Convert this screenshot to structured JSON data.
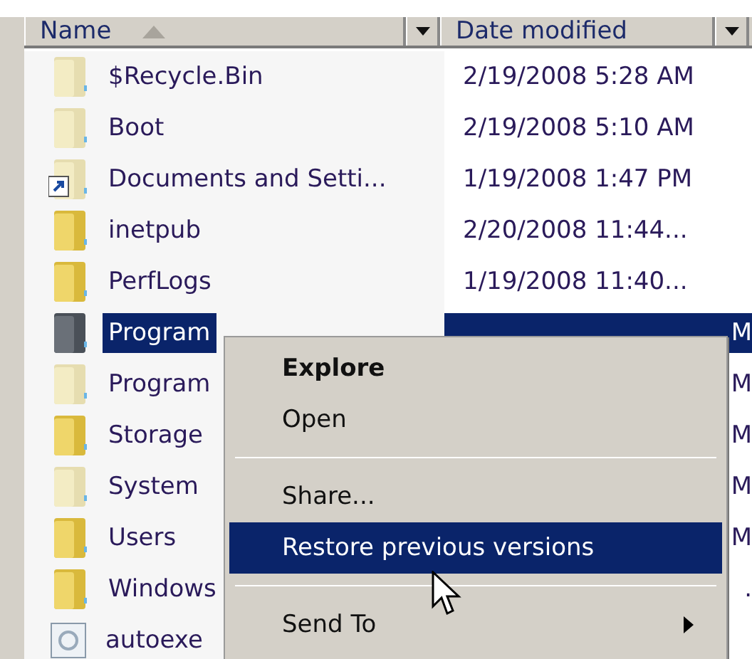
{
  "columns": [
    {
      "label": "Name",
      "sorted": true
    },
    {
      "label": "Date modified",
      "sorted": false
    }
  ],
  "rows": [
    {
      "name": "$Recycle.Bin",
      "date": "2/19/2008 5:28 AM",
      "kind": "hidden-folder",
      "selected": false
    },
    {
      "name": "Boot",
      "date": "2/19/2008 5:10 AM",
      "kind": "hidden-folder",
      "selected": false
    },
    {
      "name": "Documents and Setti...",
      "date": "1/19/2008 1:47 PM",
      "kind": "shortcut",
      "selected": false
    },
    {
      "name": "inetpub",
      "date": "2/20/2008 11:44...",
      "kind": "folder",
      "selected": false
    },
    {
      "name": "PerfLogs",
      "date": "1/19/2008 11:40...",
      "kind": "folder",
      "selected": false
    },
    {
      "name": "Program",
      "date": "M",
      "kind": "folder",
      "selected": true
    },
    {
      "name": "Program",
      "date": "M",
      "kind": "hidden-folder",
      "selected": false
    },
    {
      "name": "Storage",
      "date": "M",
      "kind": "folder",
      "selected": false
    },
    {
      "name": "System",
      "date": "M",
      "kind": "hidden-folder",
      "selected": false
    },
    {
      "name": "Users",
      "date": "M",
      "kind": "folder",
      "selected": false
    },
    {
      "name": "Windows",
      "date": ".",
      "kind": "folder",
      "selected": false
    },
    {
      "name": "autoexe",
      "date": "",
      "kind": "file",
      "selected": false
    }
  ],
  "context_menu": {
    "items": [
      {
        "kind": "item",
        "label": "Explore",
        "default": true,
        "selected": false
      },
      {
        "kind": "item",
        "label": "Open",
        "default": false,
        "selected": false
      },
      {
        "kind": "separator"
      },
      {
        "kind": "item",
        "label": "Share...",
        "default": false,
        "selected": false
      },
      {
        "kind": "item",
        "label": "Restore previous versions",
        "default": false,
        "selected": true
      },
      {
        "kind": "separator"
      },
      {
        "kind": "submenu",
        "label": "Send To",
        "default": false,
        "selected": false
      }
    ]
  }
}
